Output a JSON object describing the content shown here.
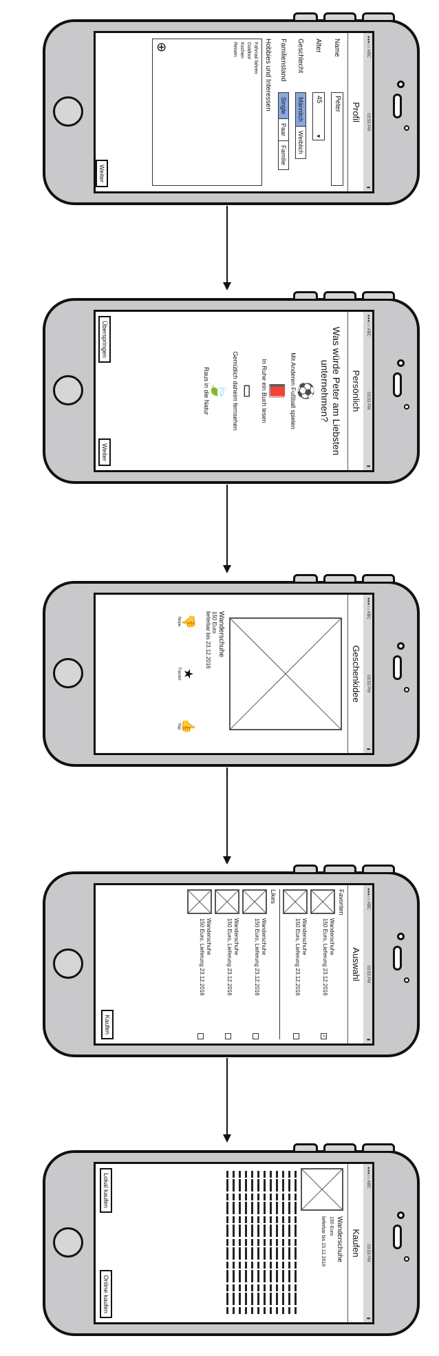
{
  "status": {
    "carrier": "●●●○○ ABC",
    "time": "03:53 PM",
    "battery": "▮"
  },
  "screens": {
    "profile": {
      "title": "Profil",
      "name_label": "Name",
      "name_value": "Peter",
      "age_label": "Alter",
      "age_value": "45",
      "gender_label": "Geschlecht",
      "gender_options": [
        "Männlich",
        "Weiblich"
      ],
      "status_label": "Familienstand",
      "status_options": [
        "Single",
        "Paar",
        "Familie"
      ],
      "hobbies_label": "Hobbies und Interessen",
      "hobbies": [
        "Fahrrad fahren",
        "Outdoor",
        "Kochen",
        "Reisen"
      ],
      "next_button": "Weiter"
    },
    "personal": {
      "title": "Persönlich",
      "question": "Was würde Peter am Liebsten unternehmen?",
      "options": [
        {
          "icon": "soccer-ball-icon",
          "glyph": "⚽",
          "label": "Mit Anderen Fußball spielen"
        },
        {
          "icon": "book-icon",
          "glyph": "📕",
          "label": "In Ruhe ein Buch lesen"
        },
        {
          "icon": "tv-icon",
          "glyph": "▭",
          "label": "Gemütlich daheim fernsehen"
        },
        {
          "icon": "leaf-icon",
          "glyph": "🍃",
          "label": "Raus in die Natur"
        }
      ],
      "skip_button": "Überspringen",
      "next_button": "Weiter"
    },
    "gift_idea": {
      "title": "Geschenkidee",
      "product_name": "Wanderschuhe",
      "price": "150 Euro",
      "delivery": "lieferbar bis 23.12.2016",
      "vote_labels": [
        "Nope",
        "Favorit",
        "Yep"
      ]
    },
    "selection": {
      "title": "Auswahl",
      "favorites_heading": "Favoriten",
      "likes_heading": "Likes",
      "item_name": "Wanderschuhe",
      "item_sub": "150 Euro, Lieferung 23.12.2016",
      "buy_button": "Kaufen"
    },
    "buy": {
      "title": "Kaufen",
      "product_name": "Wanderschuhe",
      "price": "150 Euro",
      "delivery": "lieferbar bis 23.12.2016",
      "local_button": "Lokal kaufen",
      "online_button": "Online kaufen"
    }
  }
}
